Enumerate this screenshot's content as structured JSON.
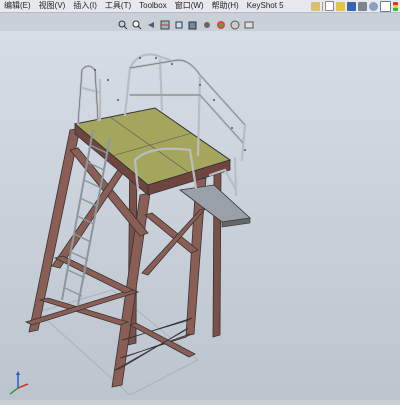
{
  "menu": {
    "items": [
      {
        "label": "编辑(E)"
      },
      {
        "label": "视图(V)"
      },
      {
        "label": "插入(I)"
      },
      {
        "label": "工具(T)"
      },
      {
        "label": "Toolbox"
      },
      {
        "label": "窗口(W)"
      },
      {
        "label": "帮助(H)"
      },
      {
        "label": "KeyShot 5"
      }
    ],
    "right_icons": [
      "pin-icon",
      "new-document-icon",
      "open-folder-icon",
      "save-icon",
      "print-icon",
      "undo-icon",
      "select-arrow-icon",
      "traffic-light-icon"
    ]
  },
  "heads_up_toolbar": {
    "icons": [
      "zoom-to-fit-icon",
      "zoom-area-icon",
      "previous-view-icon",
      "section-view-icon",
      "view-orientation-icon",
      "display-style-icon",
      "hide-show-icon",
      "edit-appearance-icon",
      "apply-scene-icon",
      "view-settings-icon"
    ]
  },
  "viewport": {
    "background_top": "#d6dde6",
    "background_bottom": "#bcc4ce",
    "model": "steel-platform-with-ladder",
    "triad_axes": [
      "x",
      "y",
      "z"
    ]
  },
  "colors": {
    "frame": "#8a5e55",
    "frame_dark": "#5e3b34",
    "deck": "#a5a65e",
    "rail": "#c4c8cc",
    "edge": "#333333"
  }
}
